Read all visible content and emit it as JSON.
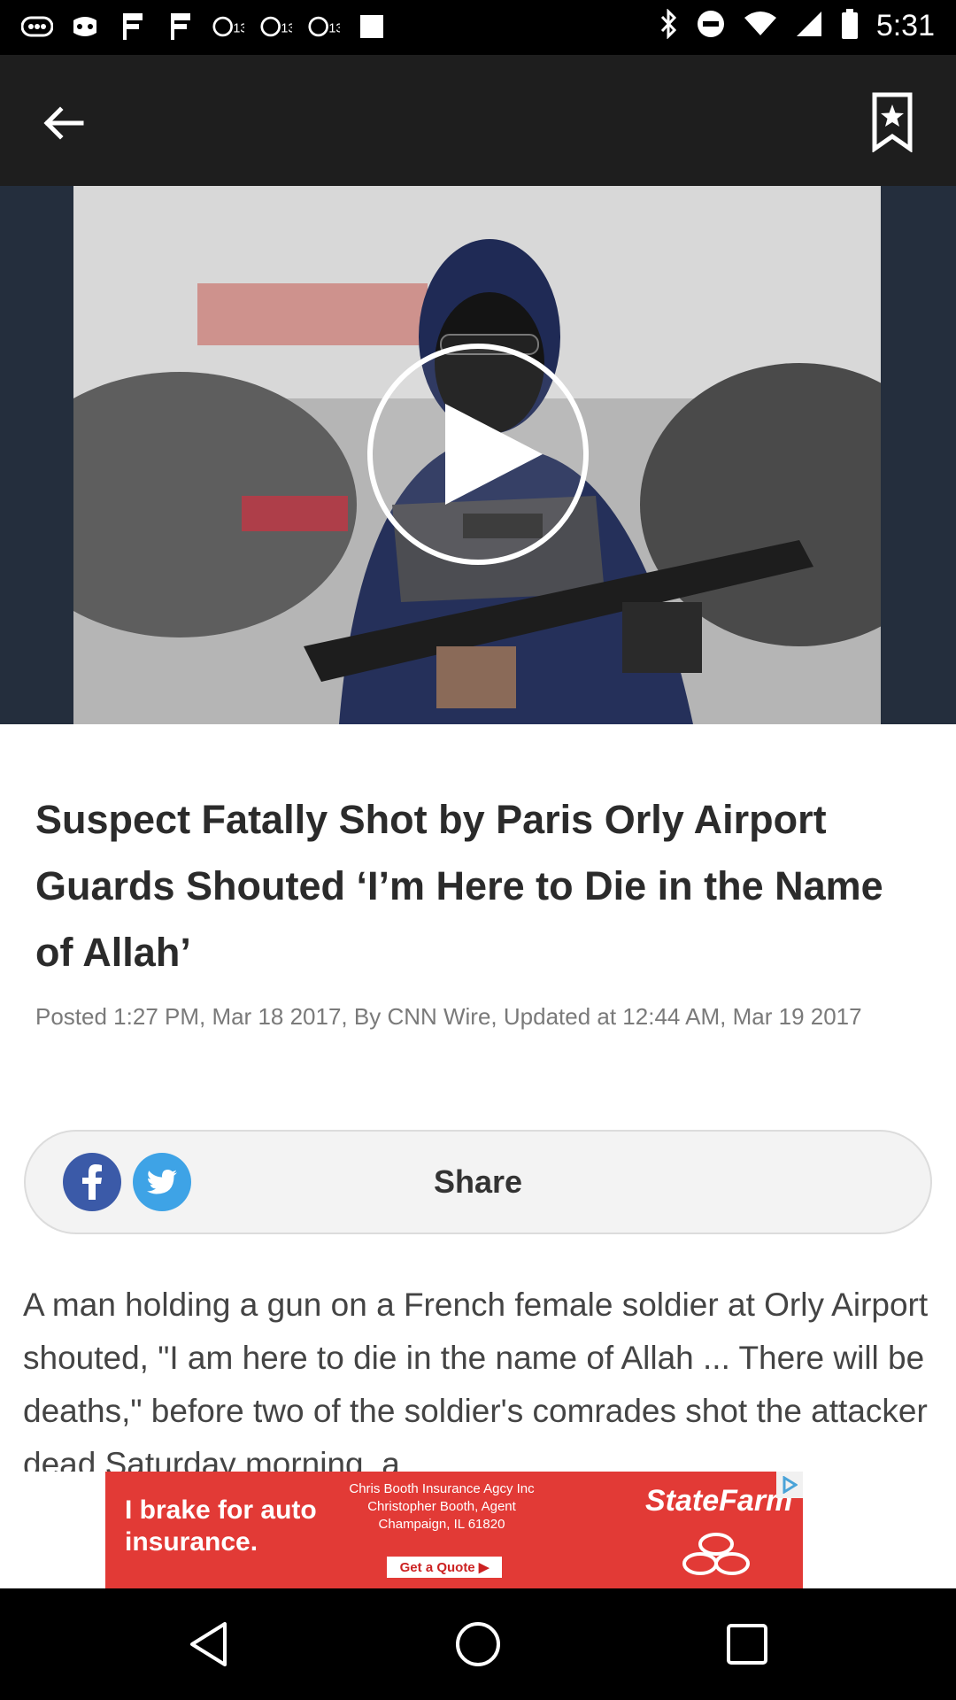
{
  "status_bar": {
    "time": "5:31",
    "icons": [
      "notification-icon",
      "game-icon",
      "flag-icon",
      "flag-icon",
      "abc13-icon",
      "abc13-icon",
      "abc13-icon",
      "square-icon",
      "bluetooth-icon",
      "dnd-icon",
      "wifi-icon",
      "signal-icon",
      "battery-icon"
    ]
  },
  "toolbar": {
    "back_icon": "arrow-left-icon",
    "bookmark_icon": "bookmark-star-icon"
  },
  "video": {
    "play_icon": "play-icon"
  },
  "article": {
    "headline": "Suspect Fatally Shot by Paris Orly Airport Guards Shouted ‘I’m Here to Die in the Name of Allah’",
    "meta": "Posted 1:27 PM, Mar 18 2017, By CNN Wire, Updated at 12:44 AM, Mar 19 2017",
    "body": "A man holding a gun on a French female soldier at Orly Airport shouted, \"I am here to die in the name of Allah ... There will be deaths,\" before two of the soldier's comrades shot the attacker dead Saturday morning, a"
  },
  "share": {
    "label": "Share",
    "facebook_icon": "facebook-icon",
    "twitter_icon": "twitter-icon",
    "facebook_color": "#3b5aa8",
    "twitter_color": "#3ea3e6"
  },
  "ad": {
    "headline": "I brake for auto insurance.",
    "details": "Chris Booth Insurance Agcy Inc Christopher Booth, Agent Champaign, IL 61820",
    "cta": "Get a Quote ▶",
    "brand": "StateFarm",
    "color": "#e23a36"
  },
  "nav": {
    "back_icon": "nav-back-icon",
    "home_icon": "nav-home-icon",
    "recents_icon": "nav-recents-icon"
  }
}
